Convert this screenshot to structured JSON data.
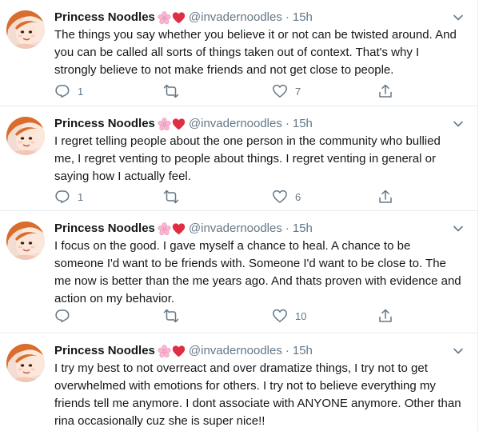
{
  "tweets": [
    {
      "name": "Princess Noodles",
      "emojis": [
        "cherry-blossom",
        "red-heart"
      ],
      "handle": "@invadernoodles",
      "dot": "·",
      "time": "15h",
      "text": "The things you say whether you believe it or not can be twisted around. And you can be called all sorts of things taken out of context. That's why I strongly believe to not make friends and not get close to people.",
      "replies": "1",
      "retweets": "",
      "likes": "7"
    },
    {
      "name": "Princess Noodles",
      "emojis": [
        "cherry-blossom",
        "red-heart"
      ],
      "handle": "@invadernoodles",
      "dot": "·",
      "time": "15h",
      "text": "I regret telling people about the one person in the community who bullied me, I regret venting to people about things. I regret venting in general or saying how I actually feel.",
      "replies": "1",
      "retweets": "",
      "likes": "6"
    },
    {
      "name": "Princess Noodles",
      "emojis": [
        "cherry-blossom",
        "red-heart"
      ],
      "handle": "@invadernoodles",
      "dot": "·",
      "time": "15h",
      "text": "I focus on the good. I gave myself a chance to heal. A chance to be someone I'd want to be friends with. Someone I'd want to be close to. The me now is better than the me years ago. And thats proven with evidence and action on my behavior.",
      "replies": "",
      "retweets": "",
      "likes": "10"
    },
    {
      "name": "Princess Noodles",
      "emojis": [
        "cherry-blossom",
        "red-heart"
      ],
      "handle": "@invadernoodles",
      "dot": "·",
      "time": "15h",
      "text": "I try my best to not overreact and over dramatize things, I try not to get overwhelmed with emotions for others. I try not to believe everything my friends tell me anymore. I dont associate with ANYONE anymore. Other than rina occasionally cuz she is super nice!!",
      "replies": "",
      "retweets": "",
      "likes": ""
    }
  ],
  "colors": {
    "text": "#14171a",
    "secondary": "#657786",
    "divider": "#e6ecf0",
    "heart_emoji": "#dd2e44",
    "blossom_emoji": "#f7b7d2"
  },
  "icons": [
    "reply-icon",
    "retweet-icon",
    "like-icon",
    "share-icon",
    "chevron-down-icon"
  ]
}
